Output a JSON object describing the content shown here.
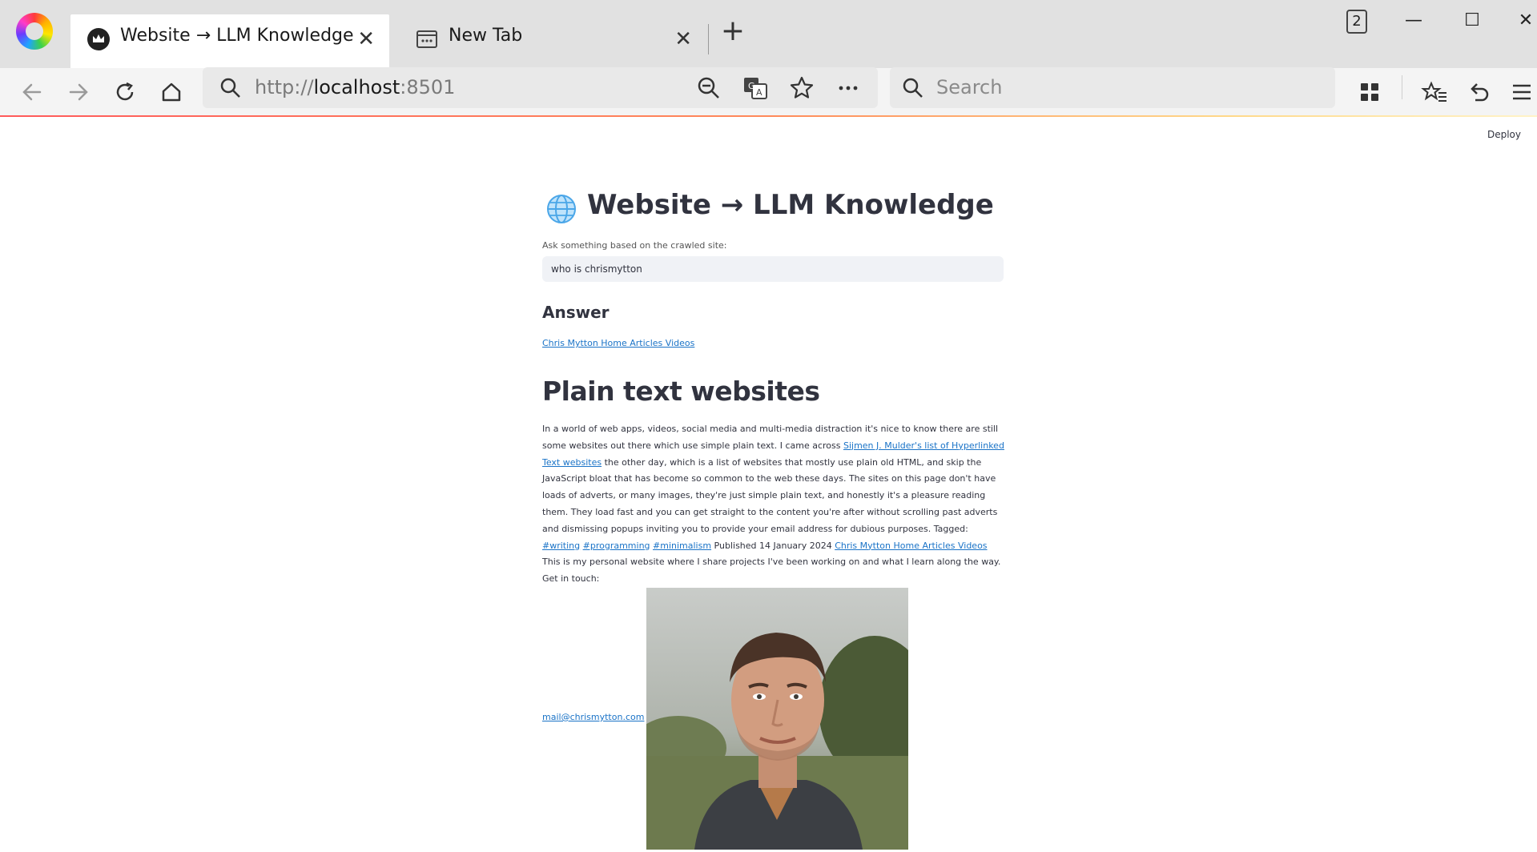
{
  "browser": {
    "tabs": [
      {
        "title": "Website → LLM Knowledge",
        "active": true,
        "icon": "crown-icon"
      },
      {
        "title": "New Tab",
        "active": false,
        "icon": "newtab-icon"
      }
    ],
    "tab_count": "2",
    "url_scheme": "http://",
    "url_host": "localhost",
    "url_port": ":8501",
    "search_placeholder": "Search"
  },
  "app": {
    "deploy_label": "Deploy",
    "title": "Website → LLM Knowledge",
    "title_icon": "globe-icon",
    "input_label": "Ask something based on the crawled site:",
    "input_value": "who is chrismytton",
    "answer_heading": "Answer",
    "top_links": "Chris Mytton Home Articles Videos",
    "section_heading": "Plain text websites",
    "body": {
      "p1": "In a world of web apps, videos, social media and multi-media distraction it's nice to know there are still some websites out there which use simple plain text. I came across ",
      "link1": "Sijmen J. Mulder's list of Hyperlinked Text websites",
      "p2": " the other day, which is a list of websites that mostly use plain old HTML, and skip the JavaScript bloat that has become so common to the web these days. The sites on this page don't have loads of adverts, or many images, they're just simple plain text, and honestly it's a pleasure reading them. They load fast and you can get straight to the content you're after without scrolling past adverts and dismissing popups inviting you to provide your email address for dubious purposes. Tagged: ",
      "tag1": "#writing",
      "tag2": "#programming",
      "tag3": "#minimalism",
      "p3": " Published 14 January 2024 ",
      "link2": "Chris Mytton Home Articles Videos",
      "p4": " This is my personal website where I share projects I've been working on and what I learn along the way. Get in touch:"
    },
    "mail_link": "mail@chrismytton.com",
    "portrait": "portrait-photo"
  },
  "colors": {
    "link": "#1a73c7",
    "text": "#31333f",
    "input_bg": "#f0f2f6"
  }
}
